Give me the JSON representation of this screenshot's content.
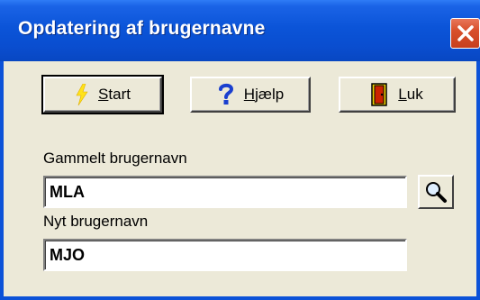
{
  "window": {
    "title": "Opdatering af brugernavne"
  },
  "toolbar": {
    "start": {
      "mnemonic": "S",
      "rest": "tart",
      "icon": "lightning-icon"
    },
    "help": {
      "mnemonic": "H",
      "rest": "jælp",
      "icon": "question-mark-icon"
    },
    "close": {
      "mnemonic": "L",
      "rest": "uk",
      "icon": "exit-door-icon"
    }
  },
  "form": {
    "old_label": "Gammelt brugernavn",
    "old_value": "MLA",
    "new_label": "Nyt brugernavn",
    "new_value": "MJO",
    "search_icon": "magnifier-icon"
  },
  "colors": {
    "titlebar": "#0b54d8",
    "window_bg": "#ece9d8",
    "close_button": "#d8502c"
  }
}
